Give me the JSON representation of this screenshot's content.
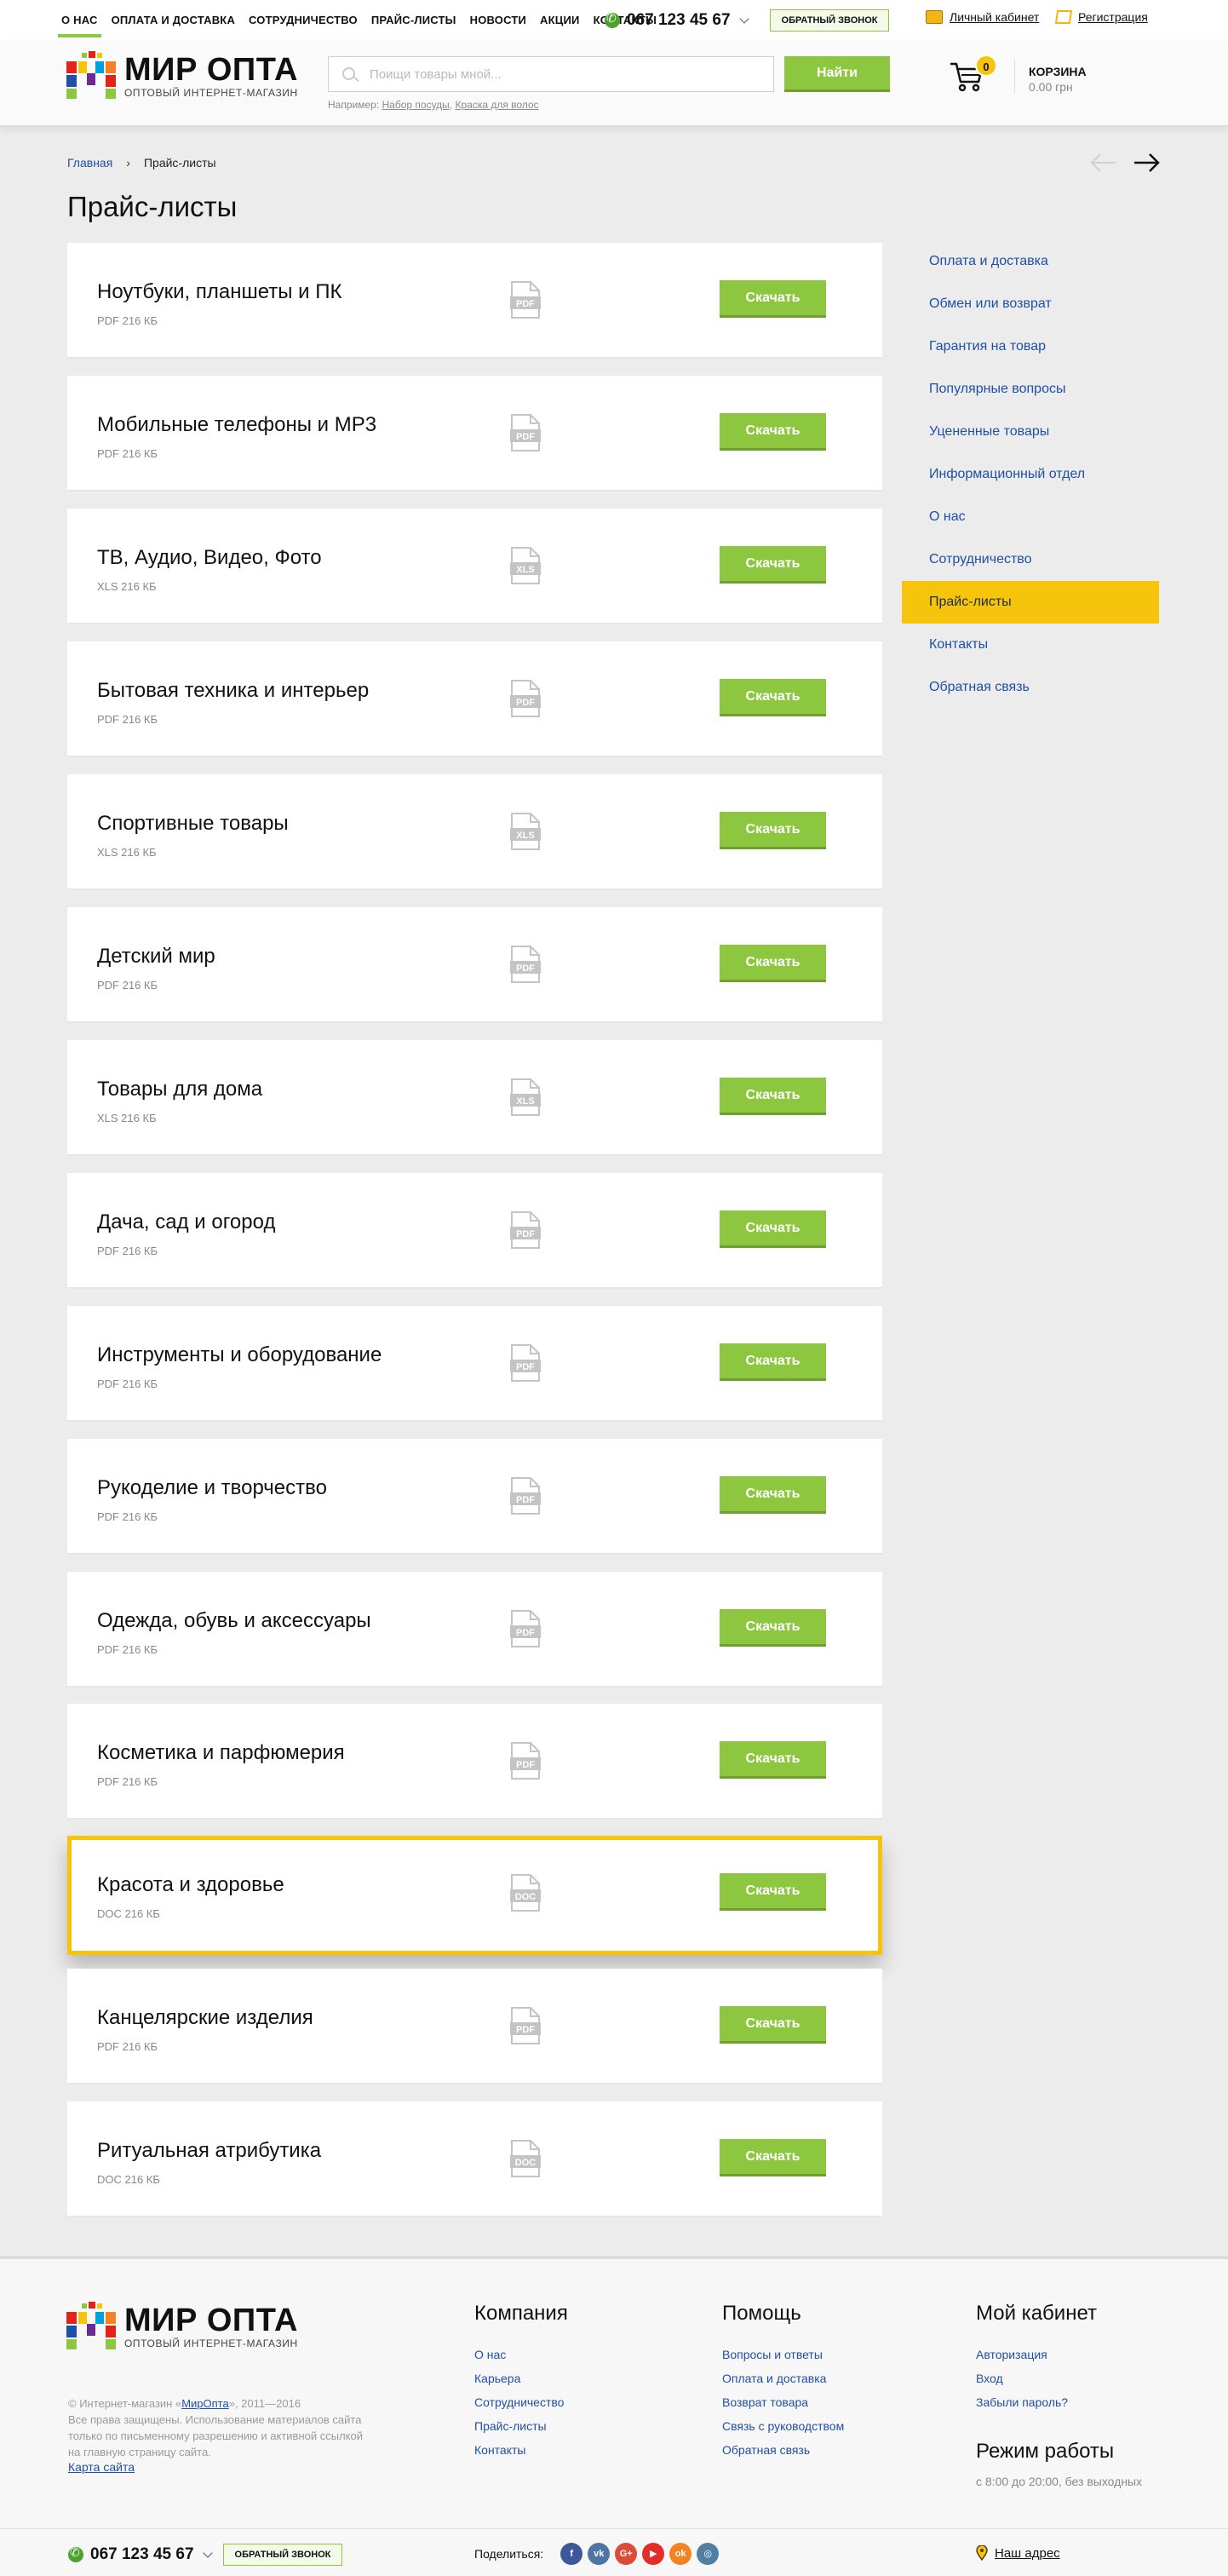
{
  "topnav": {
    "items": [
      {
        "label": "О НАС",
        "active": true
      },
      {
        "label": "ОПЛАТА И ДОСТАВКА"
      },
      {
        "label": "СОТРУДНИЧЕСТВО"
      },
      {
        "label": "ПРАЙС-ЛИСТЫ"
      },
      {
        "label": "НОВОСТИ"
      },
      {
        "label": "АКЦИИ"
      },
      {
        "label": "КОНТАКТЫ"
      }
    ],
    "phone": "067 123 45 67",
    "callback_label": "ОБРАТНЫЙ ЗВОНОК",
    "account_label": "Личный кабинет",
    "register_label": "Регистрация"
  },
  "header": {
    "logo_title": "МИР ОПТА",
    "logo_subtitle": "ОПТОВЫЙ ИНТЕРНЕТ-МАГАЗИН",
    "search_placeholder": "Поищи товары мной...",
    "search_button": "Найти",
    "hint_prefix": "Например:",
    "hint_link_1": "Набор посуды",
    "hint_sep": ",",
    "hint_link_2": "Краска для волос",
    "cart_count": "0",
    "cart_title": "КОРЗИНА",
    "cart_sum": "0.00 грн"
  },
  "breadcrumb": {
    "home": "Главная",
    "separator": "›",
    "current": "Прайс-листы"
  },
  "page_title": "Прайс-листы",
  "price_lists": [
    {
      "name": "Ноутбуки, планшеты и ПК",
      "meta": "PDF 216 КБ",
      "type": "PDF",
      "button": "Скачать"
    },
    {
      "name": "Мобильные телефоны и MP3",
      "meta": "PDF 216 КБ",
      "type": "PDF",
      "button": "Скачать"
    },
    {
      "name": "ТВ, Аудио, Видео, Фото",
      "meta": "XLS 216 КБ",
      "type": "XLS",
      "button": "Скачать"
    },
    {
      "name": "Бытовая техника и интерьер",
      "meta": "PDF 216 КБ",
      "type": "PDF",
      "button": "Скачать"
    },
    {
      "name": "Спортивные товары",
      "meta": "XLS 216 КБ",
      "type": "XLS",
      "button": "Скачать"
    },
    {
      "name": "Детский мир",
      "meta": "PDF 216 КБ",
      "type": "PDF",
      "button": "Скачать"
    },
    {
      "name": "Товары для дома",
      "meta": "XLS 216 КБ",
      "type": "XLS",
      "button": "Скачать"
    },
    {
      "name": "Дача, сад и огород",
      "meta": "PDF 216 КБ",
      "type": "PDF",
      "button": "Скачать"
    },
    {
      "name": "Инструменты и оборудование",
      "meta": "PDF 216 КБ",
      "type": "PDF",
      "button": "Скачать"
    },
    {
      "name": "Рукоделие и творчество",
      "meta": "PDF 216 КБ",
      "type": "PDF",
      "button": "Скачать"
    },
    {
      "name": "Одежда, обувь и аксессуары",
      "meta": "PDF 216 КБ",
      "type": "PDF",
      "button": "Скачать"
    },
    {
      "name": "Косметика и парфюмерия",
      "meta": "PDF 216 КБ",
      "type": "PDF",
      "button": "Скачать"
    },
    {
      "name": "Красота и здоровье",
      "meta": "DOC 216 КБ",
      "type": "DOC",
      "button": "Скачать",
      "highlighted": true
    },
    {
      "name": "Канцелярские изделия",
      "meta": "PDF 216 КБ",
      "type": "PDF",
      "button": "Скачать"
    },
    {
      "name": "Ритуальная атрибутика",
      "meta": "DOC 216 КБ",
      "type": "DOC",
      "button": "Скачать"
    }
  ],
  "sidebar": {
    "items": [
      {
        "label": "Оплата и доставка"
      },
      {
        "label": "Обмен или возврат"
      },
      {
        "label": "Гарантия на товар"
      },
      {
        "label": "Популярные вопросы"
      },
      {
        "label": "Уцененные товары"
      },
      {
        "label": "Информационный отдел"
      },
      {
        "label": "О нас"
      },
      {
        "label": "Сотрудничество"
      },
      {
        "label": "Прайс-листы",
        "active": true
      },
      {
        "label": "Контакты"
      },
      {
        "label": "Обратная связь"
      }
    ]
  },
  "footer": {
    "logo_title": "МИР ОПТА",
    "logo_subtitle": "ОПТОВЫЙ ИНТЕРНЕТ-МАГАЗИН",
    "copyright_prefix": "© Интернет-магазин «",
    "copyright_brand": "МирОпта",
    "copyright_suffix": "», 2011—2016",
    "rights_text": "Все права защищены. Использование материалов сайта только по письменному разрешению и активной ссылкой на главную страницу сайта.",
    "sitemap": "Карта сайта",
    "columns": [
      {
        "title": "Компания",
        "links": [
          "О нас",
          "Карьера",
          "Сотрудничество",
          "Прайс-листы",
          "Контакты"
        ]
      },
      {
        "title": "Помощь",
        "links": [
          "Вопросы и ответы",
          "Оплата и доставка",
          "Возврат товара",
          "Связь с руководством",
          "Обратная связь"
        ]
      },
      {
        "title": "Мой кабинет",
        "links": [
          "Авторизация",
          "Вход",
          "Забыли пароль?"
        ]
      }
    ],
    "hours_title": "Режим работы",
    "hours": "с 8:00 до 20:00, без выходных",
    "phone": "067 123 45 67",
    "callback_label": "ОБРАТНЫЙ ЗВОНОК",
    "share_label": "Поделиться:",
    "socials": [
      {
        "name": "facebook",
        "glyph": "f",
        "color": "#3b5998"
      },
      {
        "name": "vkontakte",
        "glyph": "vk",
        "color": "#4c75a3"
      },
      {
        "name": "google-plus",
        "glyph": "G+",
        "color": "#dd4b39"
      },
      {
        "name": "youtube",
        "glyph": "▶",
        "color": "#e52d27"
      },
      {
        "name": "odnoklassniki",
        "glyph": "ok",
        "color": "#f58220"
      },
      {
        "name": "instagram",
        "glyph": "◎",
        "color": "#517fa4"
      }
    ],
    "address": "Наш адрес"
  },
  "colors": {
    "accent_green": "#8dc63f",
    "accent_yellow": "#f6c40a",
    "link_blue": "#1f4fa8"
  }
}
